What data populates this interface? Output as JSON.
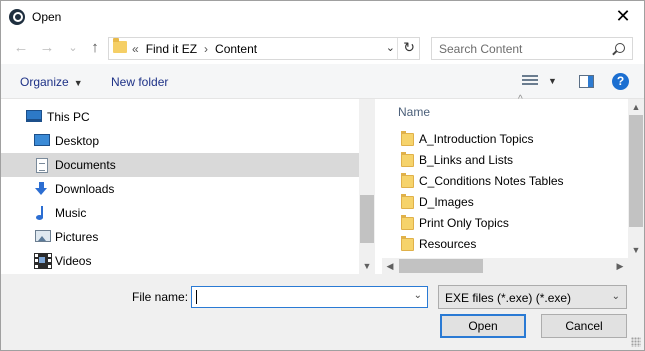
{
  "window": {
    "title": "Open",
    "close_glyph": "✕"
  },
  "navigation": {
    "back_glyph": "←",
    "forward_glyph": "→",
    "recent_glyph": "⌄",
    "up_glyph": "↑"
  },
  "address_bar": {
    "overflow_glyph": "«",
    "crumbs": [
      "Find it EZ",
      "Content"
    ],
    "separator_glyph": "›",
    "dropdown_glyph": "⌄",
    "refresh_glyph": "↻"
  },
  "search": {
    "placeholder": "Search Content"
  },
  "toolbar": {
    "organize_label": "Organize",
    "dropdown_glyph": "▼",
    "new_folder_label": "New folder",
    "view_caret_glyph": "▼",
    "help_label": "?"
  },
  "sidebar": {
    "items": [
      {
        "label": "This PC",
        "icon": "computer-icon"
      },
      {
        "label": "Desktop",
        "icon": "desktop-icon"
      },
      {
        "label": "Documents",
        "icon": "documents-icon",
        "selected": true
      },
      {
        "label": "Downloads",
        "icon": "downloads-icon"
      },
      {
        "label": "Music",
        "icon": "music-icon"
      },
      {
        "label": "Pictures",
        "icon": "pictures-icon"
      },
      {
        "label": "Videos",
        "icon": "videos-icon"
      }
    ]
  },
  "scroll_glyphs": {
    "up": "▲",
    "down": "▼",
    "left": "◀",
    "right": "▶",
    "sort": "^"
  },
  "content": {
    "column_header": "Name",
    "files": [
      {
        "name": "A_Introduction Topics",
        "icon": "folder-icon"
      },
      {
        "name": "B_Links and Lists",
        "icon": "folder-icon"
      },
      {
        "name": "C_Conditions Notes Tables",
        "icon": "folder-icon"
      },
      {
        "name": "D_Images",
        "icon": "folder-icon"
      },
      {
        "name": "Print Only Topics",
        "icon": "folder-icon"
      },
      {
        "name": "Resources",
        "icon": "folder-icon"
      }
    ]
  },
  "footer": {
    "file_name_label": "File name:",
    "file_name_value": "",
    "file_type_value": "EXE files (*.exe) (*.exe)",
    "dropdown_glyph": "⌄",
    "open_label": "Open",
    "cancel_label": "Cancel"
  },
  "colors": {
    "link": "#1e3287",
    "focus": "#2a7ad4",
    "folder": "#f6d36b",
    "selection": "#d9d9d9"
  }
}
